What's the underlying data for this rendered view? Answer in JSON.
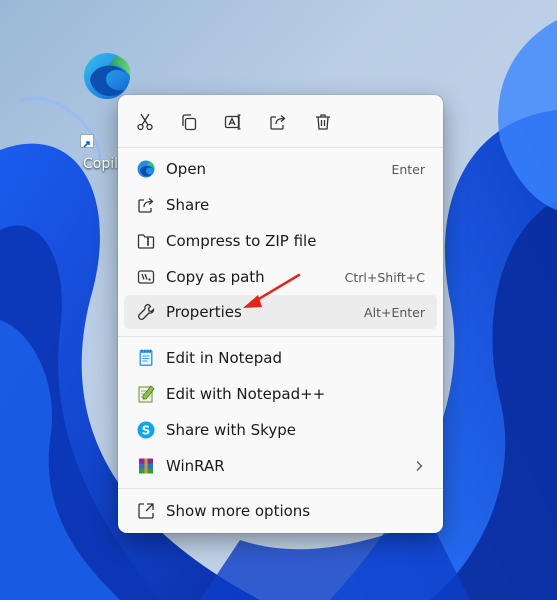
{
  "desktop": {
    "shortcut_label": "Copil",
    "accent": "#1a4fd8"
  },
  "toolbar": {
    "buttons": [
      {
        "icon": "scissors-icon",
        "action": "cut"
      },
      {
        "icon": "copy-icon",
        "action": "copy"
      },
      {
        "icon": "rename-icon",
        "action": "rename"
      },
      {
        "icon": "share-icon",
        "action": "share"
      },
      {
        "icon": "trash-icon",
        "action": "delete"
      }
    ]
  },
  "menu": {
    "primary": [
      {
        "icon": "edge-icon",
        "label": "Open",
        "shortcut": "Enter"
      },
      {
        "icon": "share-icon",
        "label": "Share",
        "shortcut": ""
      },
      {
        "icon": "zip-icon",
        "label": "Compress to ZIP file",
        "shortcut": ""
      },
      {
        "icon": "path-icon",
        "label": "Copy as path",
        "shortcut": "Ctrl+Shift+C"
      },
      {
        "icon": "wrench-icon",
        "label": "Properties",
        "shortcut": "Alt+Enter",
        "highlighted": true
      }
    ],
    "apps": [
      {
        "icon": "notepad-icon",
        "label": "Edit in Notepad"
      },
      {
        "icon": "notepadpp-icon",
        "label": "Edit with Notepad++"
      },
      {
        "icon": "skype-icon",
        "label": "Share with Skype"
      },
      {
        "icon": "winrar-icon",
        "label": "WinRAR",
        "submenu": true
      }
    ],
    "footer": {
      "icon": "more-options-icon",
      "label": "Show more options"
    }
  },
  "annotation": {
    "color": "#e0251b",
    "points_to": "Properties"
  }
}
